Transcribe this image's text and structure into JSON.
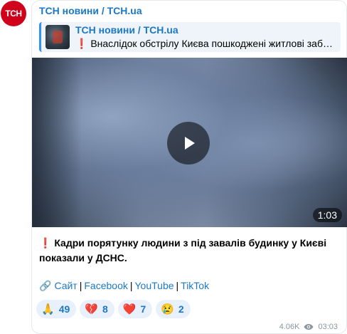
{
  "channel": {
    "avatar_text": "ТСН",
    "brand_color": "#d0021b"
  },
  "message": {
    "sender": "ТСН новини / TCH.ua",
    "reply": {
      "title": "ТСН новини / TCH.ua",
      "text": "❗ Внаслідок обстрілу Києва пошкоджені житлові заб…"
    },
    "video": {
      "duration": "1:03"
    },
    "caption_mark": "❗",
    "caption": "Кадри порятунку людини з під завалів будинку у Києві показали у ДСНС.",
    "links": {
      "chain_icon": "🔗",
      "items": [
        "Сайт",
        "Facebook",
        "YouTube",
        "TikTok"
      ],
      "separator": "|"
    },
    "reactions": [
      {
        "emoji": "🙏",
        "count": "49"
      },
      {
        "emoji": "💔",
        "count": "8"
      },
      {
        "emoji": "❤️",
        "count": "7"
      },
      {
        "emoji": "😢",
        "count": "2"
      }
    ],
    "views": "4.06K",
    "time": "03:03"
  }
}
